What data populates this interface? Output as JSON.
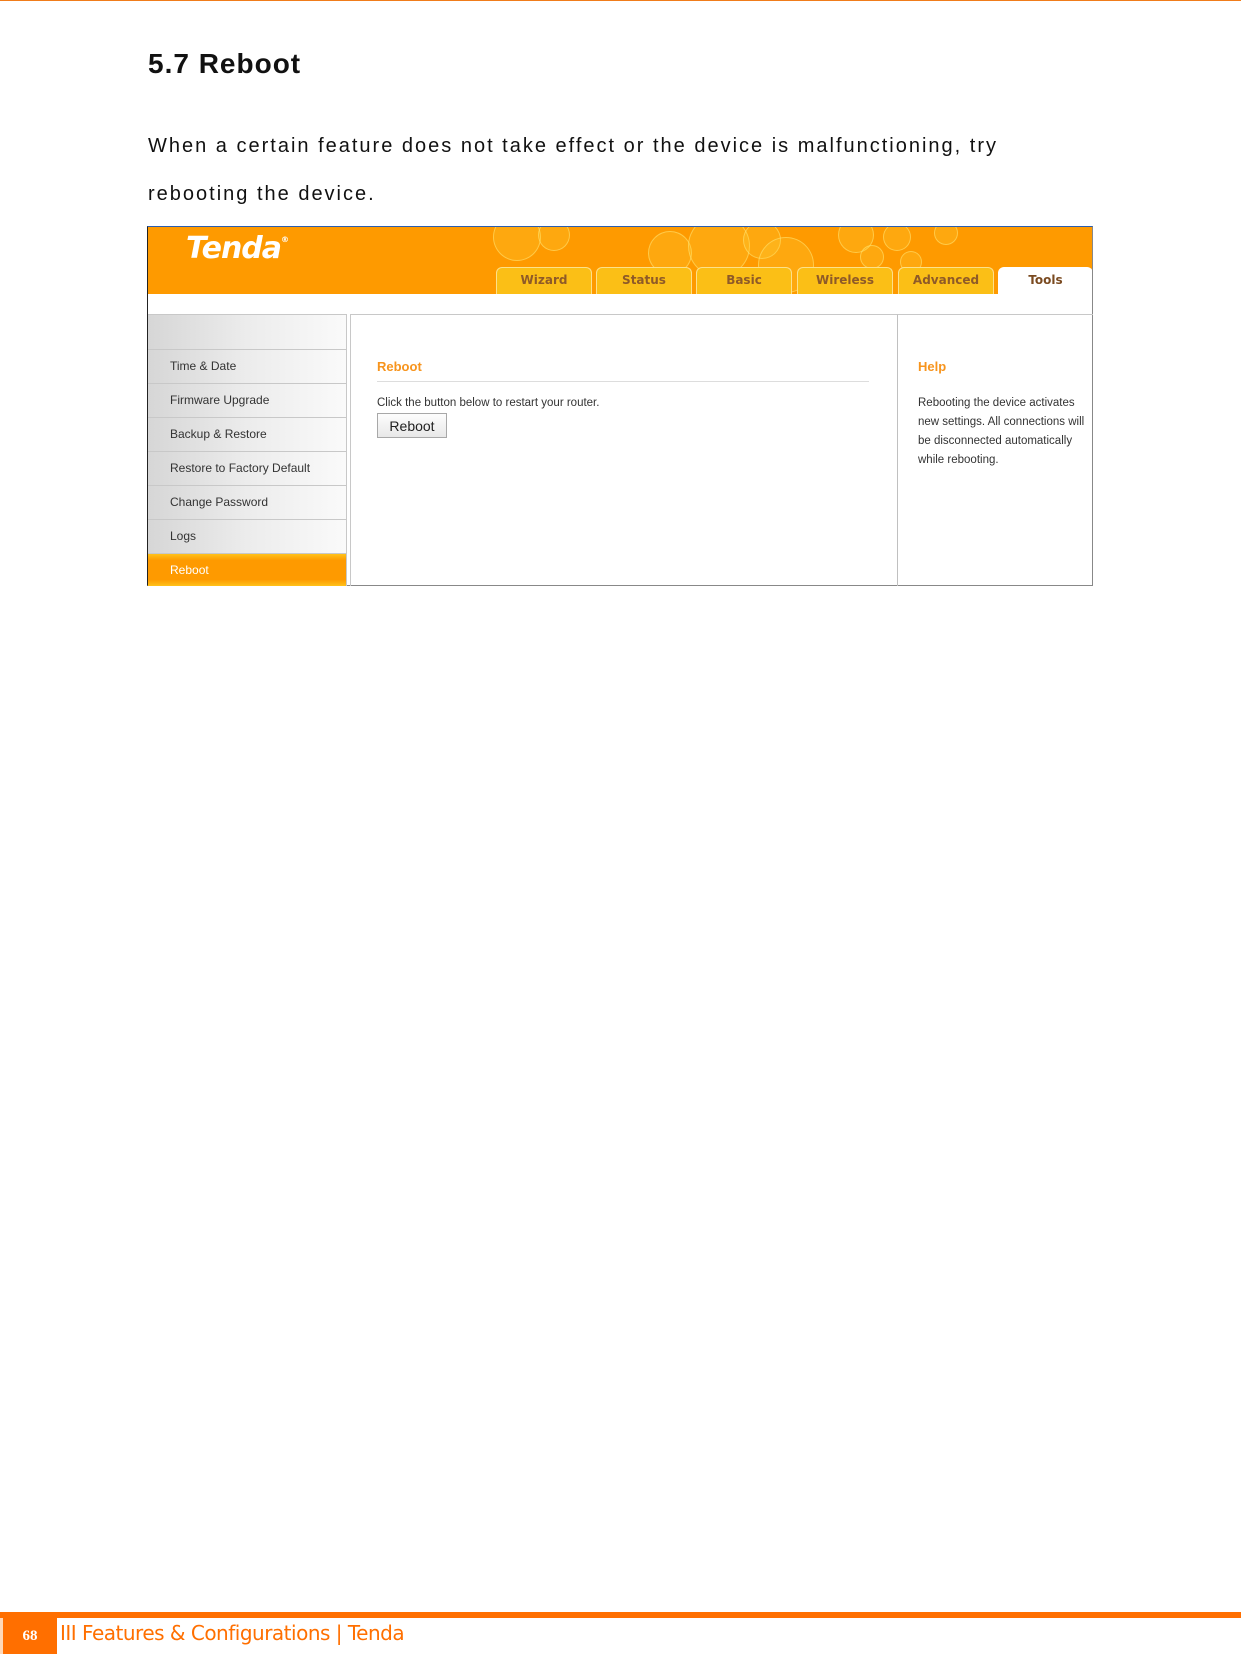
{
  "document": {
    "section_heading": "5.7 Reboot",
    "paragraph": "When a certain feature does not take effect or the device is malfunctioning, try rebooting the device."
  },
  "router_ui": {
    "logo": "Tenda",
    "logo_mark": "®",
    "tabs": [
      {
        "label": "Wizard",
        "active": false
      },
      {
        "label": "Status",
        "active": false
      },
      {
        "label": "Basic",
        "active": false
      },
      {
        "label": "Wireless",
        "active": false
      },
      {
        "label": "Advanced",
        "active": false
      },
      {
        "label": "Tools",
        "active": true
      }
    ],
    "sidebar": {
      "items": [
        {
          "label": "Time & Date",
          "active": false
        },
        {
          "label": "Firmware Upgrade",
          "active": false
        },
        {
          "label": "Backup & Restore",
          "active": false
        },
        {
          "label": "Restore to Factory Default",
          "active": false
        },
        {
          "label": "Change Password",
          "active": false
        },
        {
          "label": "Logs",
          "active": false
        },
        {
          "label": "Reboot",
          "active": true
        }
      ]
    },
    "main": {
      "title": "Reboot",
      "instruction": "Click the button below to restart your router.",
      "reboot_button_label": "Reboot"
    },
    "help": {
      "title": "Help",
      "text": "Rebooting the device activates new settings. All connections will be disconnected automatically while rebooting."
    },
    "colors": {
      "header_orange": "#fe9a00",
      "tab_yellow": "#fbbf16",
      "tab_text": "#8e5a28",
      "section_title": "#f7941d"
    }
  },
  "footer": {
    "page_number": "68",
    "running_title": "III Features & Configurations | Tenda",
    "accent_color": "#ff6f00"
  }
}
